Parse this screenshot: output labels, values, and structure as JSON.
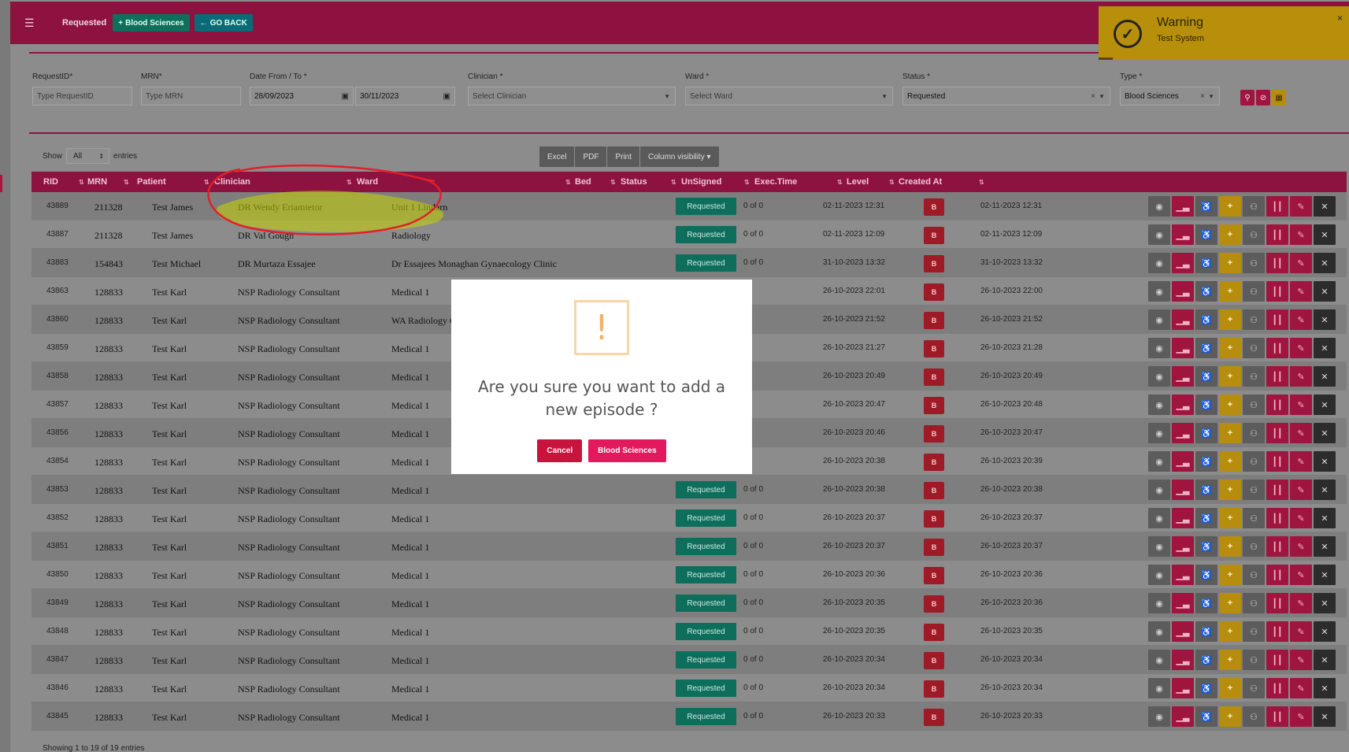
{
  "header": {
    "breadcrumb": "Requested",
    "blood_sciences_button": "Blood Sciences",
    "go_back_button": "GO BACK"
  },
  "filters": {
    "request_id": {
      "label": "RequestID*",
      "placeholder": "Type RequestID"
    },
    "mrn": {
      "label": "MRN*",
      "placeholder": "Type MRN"
    },
    "date": {
      "label": "Date From / To *",
      "from": "28/09/2023",
      "to": "30/11/2023"
    },
    "clinician": {
      "label": "Clinician *",
      "placeholder": "Select Clinician"
    },
    "ward": {
      "label": "Ward *",
      "placeholder": "Select Ward"
    },
    "status": {
      "label": "Status *",
      "value": "Requested"
    },
    "type": {
      "label": "Type *",
      "value": "Blood Sciences"
    }
  },
  "list_controls": {
    "show_label": "Show",
    "entries_label": "entries",
    "page_size": "All",
    "excel": "Excel",
    "pdf": "PDF",
    "print": "Print",
    "column_visibility": "Column visibility"
  },
  "table": {
    "columns": [
      "RID",
      "MRN",
      "Patient",
      "Clinician",
      "Ward",
      "Bed",
      "Status",
      "UnSigned",
      "Exec.Time",
      "Level",
      "Created At"
    ],
    "rows": [
      {
        "rid": "43889",
        "mrn": "211328",
        "patient": "Test James",
        "clinician": "DR Wendy Eriamietor",
        "ward": "Unit 1 Lindarn",
        "status": "Requested",
        "unsigned": "0 of 0",
        "exec": "02-11-2023 12:31",
        "level": "B",
        "created": "02-11-2023 12:31"
      },
      {
        "rid": "43887",
        "mrn": "211328",
        "patient": "Test James",
        "clinician": "DR Val Gough",
        "ward": "Radiology",
        "status": "Requested",
        "unsigned": "0 of 0",
        "exec": "02-11-2023 12:09",
        "level": "B",
        "created": "02-11-2023 12:09"
      },
      {
        "rid": "43883",
        "mrn": "154843",
        "patient": "Test Michael",
        "clinician": "DR Murtaza Essajee",
        "ward": "Dr Essajees Monaghan Gynaecology Clinic",
        "status": "Requested",
        "unsigned": "0 of 0",
        "exec": "31-10-2023 13:32",
        "level": "B",
        "created": "31-10-2023 13:32"
      },
      {
        "rid": "43863",
        "mrn": "128833",
        "patient": "Test Karl",
        "clinician": "NSP Radiology Consultant",
        "ward": "Medical 1",
        "status": "",
        "unsigned": "",
        "exec": "26-10-2023 22:01",
        "level": "B",
        "created": "26-10-2023 22:00"
      },
      {
        "rid": "43860",
        "mrn": "128833",
        "patient": "Test Karl",
        "clinician": "NSP Radiology Consultant",
        "ward": "WA Radiology CC",
        "status": "",
        "unsigned": "",
        "exec": "26-10-2023 21:52",
        "level": "B",
        "created": "26-10-2023 21:52"
      },
      {
        "rid": "43859",
        "mrn": "128833",
        "patient": "Test Karl",
        "clinician": "NSP Radiology Consultant",
        "ward": "Medical 1",
        "status": "",
        "unsigned": "",
        "exec": "26-10-2023 21:27",
        "level": "B",
        "created": "26-10-2023 21:28"
      },
      {
        "rid": "43858",
        "mrn": "128833",
        "patient": "Test Karl",
        "clinician": "NSP Radiology Consultant",
        "ward": "Medical 1",
        "status": "",
        "unsigned": "",
        "exec": "26-10-2023 20:49",
        "level": "B",
        "created": "26-10-2023 20:49"
      },
      {
        "rid": "43857",
        "mrn": "128833",
        "patient": "Test Karl",
        "clinician": "NSP Radiology Consultant",
        "ward": "Medical 1",
        "status": "",
        "unsigned": "",
        "exec": "26-10-2023 20:47",
        "level": "B",
        "created": "26-10-2023 20:48"
      },
      {
        "rid": "43856",
        "mrn": "128833",
        "patient": "Test Karl",
        "clinician": "NSP Radiology Consultant",
        "ward": "Medical 1",
        "status": "",
        "unsigned": "",
        "exec": "26-10-2023 20:46",
        "level": "B",
        "created": "26-10-2023 20:47"
      },
      {
        "rid": "43854",
        "mrn": "128833",
        "patient": "Test Karl",
        "clinician": "NSP Radiology Consultant",
        "ward": "Medical 1",
        "status": "",
        "unsigned": "",
        "exec": "26-10-2023 20:38",
        "level": "B",
        "created": "26-10-2023 20:39"
      },
      {
        "rid": "43853",
        "mrn": "128833",
        "patient": "Test Karl",
        "clinician": "NSP Radiology Consultant",
        "ward": "Medical 1",
        "status": "Requested",
        "unsigned": "0 of 0",
        "exec": "26-10-2023 20:38",
        "level": "B",
        "created": "26-10-2023 20:38"
      },
      {
        "rid": "43852",
        "mrn": "128833",
        "patient": "Test Karl",
        "clinician": "NSP Radiology Consultant",
        "ward": "Medical 1",
        "status": "Requested",
        "unsigned": "0 of 0",
        "exec": "26-10-2023 20:37",
        "level": "B",
        "created": "26-10-2023 20:37"
      },
      {
        "rid": "43851",
        "mrn": "128833",
        "patient": "Test Karl",
        "clinician": "NSP Radiology Consultant",
        "ward": "Medical 1",
        "status": "Requested",
        "unsigned": "0 of 0",
        "exec": "26-10-2023 20:37",
        "level": "B",
        "created": "26-10-2023 20:37"
      },
      {
        "rid": "43850",
        "mrn": "128833",
        "patient": "Test Karl",
        "clinician": "NSP Radiology Consultant",
        "ward": "Medical 1",
        "status": "Requested",
        "unsigned": "0 of 0",
        "exec": "26-10-2023 20:36",
        "level": "B",
        "created": "26-10-2023 20:36"
      },
      {
        "rid": "43849",
        "mrn": "128833",
        "patient": "Test Karl",
        "clinician": "NSP Radiology Consultant",
        "ward": "Medical 1",
        "status": "Requested",
        "unsigned": "0 of 0",
        "exec": "26-10-2023 20:35",
        "level": "B",
        "created": "26-10-2023 20:36"
      },
      {
        "rid": "43848",
        "mrn": "128833",
        "patient": "Test Karl",
        "clinician": "NSP Radiology Consultant",
        "ward": "Medical 1",
        "status": "Requested",
        "unsigned": "0 of 0",
        "exec": "26-10-2023 20:35",
        "level": "B",
        "created": "26-10-2023 20:35"
      },
      {
        "rid": "43847",
        "mrn": "128833",
        "patient": "Test Karl",
        "clinician": "NSP Radiology Consultant",
        "ward": "Medical 1",
        "status": "Requested",
        "unsigned": "0 of 0",
        "exec": "26-10-2023 20:34",
        "level": "B",
        "created": "26-10-2023 20:34"
      },
      {
        "rid": "43846",
        "mrn": "128833",
        "patient": "Test Karl",
        "clinician": "NSP Radiology Consultant",
        "ward": "Medical 1",
        "status": "Requested",
        "unsigned": "0 of 0",
        "exec": "26-10-2023 20:34",
        "level": "B",
        "created": "26-10-2023 20:34"
      },
      {
        "rid": "43845",
        "mrn": "128833",
        "patient": "Test Karl",
        "clinician": "NSP Radiology Consultant",
        "ward": "Medical 1",
        "status": "Requested",
        "unsigned": "0 of 0",
        "exec": "26-10-2023 20:33",
        "level": "B",
        "created": "26-10-2023 20:33"
      }
    ]
  },
  "footer": {
    "info": "Showing 1 to 19 of 19 entries"
  },
  "modal": {
    "icon": "!",
    "message": "Are you sure you want to add a new episode ?",
    "cancel": "Cancel",
    "confirm": "Blood Sciences"
  },
  "toast": {
    "title": "Warning",
    "message": "Test System",
    "close": "×"
  },
  "colors": {
    "brand": "#8d1240",
    "status_green": "#0d6e5c",
    "level_red": "#9e1a26",
    "toast_yellow": "#b78f0b",
    "annotation_red": "#e0202a",
    "annotation_highlight": "#c8d400"
  },
  "icons": [
    "hamburger-icon",
    "plus-icon",
    "arrow-left-icon",
    "search-icon",
    "clear-filter-icon",
    "calendar-icon",
    "eye-icon",
    "chart-icon",
    "wheelchair-icon",
    "plus-icon",
    "people-icon",
    "barcode-icon",
    "edit-icon",
    "close-icon",
    "exclamation-icon",
    "check-circle-icon"
  ]
}
